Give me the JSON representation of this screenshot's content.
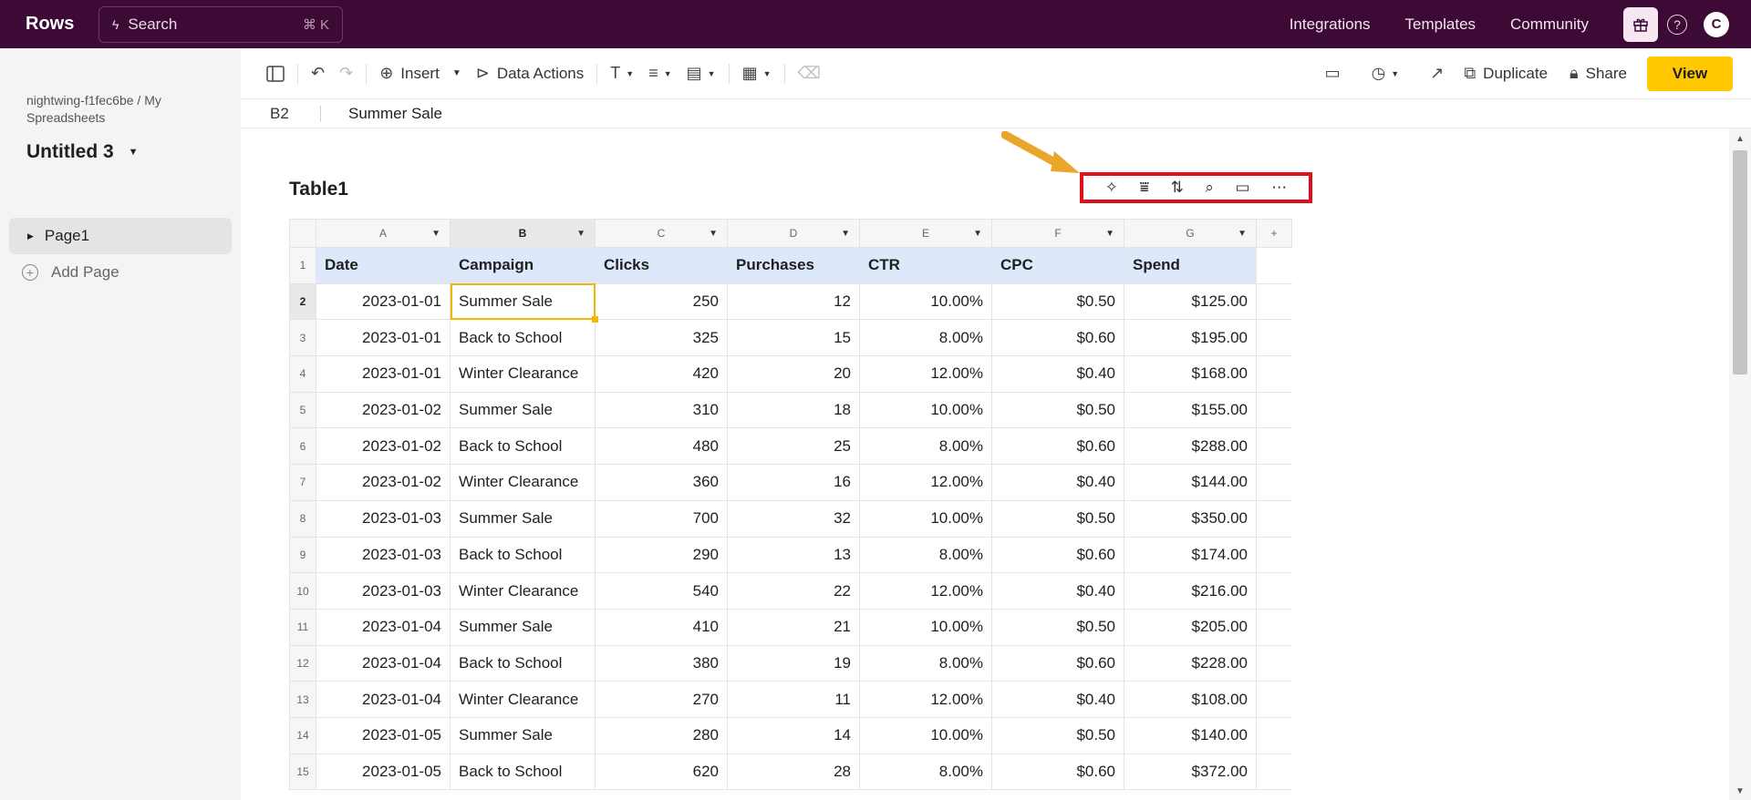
{
  "app": {
    "logo": "Rows",
    "search_label": "Search",
    "search_shortcut": "⌘ K",
    "nav": [
      "Integrations",
      "Templates",
      "Community"
    ],
    "avatar_initial": "C"
  },
  "sidebar": {
    "breadcrumb": "nightwing-f1fec6be / My Spreadsheets",
    "doc_title": "Untitled 3",
    "pages": [
      {
        "label": "Page1"
      }
    ],
    "add_page_label": "Add Page"
  },
  "toolbar": {
    "insert_label": "Insert",
    "data_actions_label": "Data Actions",
    "duplicate_label": "Duplicate",
    "share_label": "Share",
    "view_label": "View"
  },
  "formula_bar": {
    "cell_ref": "B2",
    "value": "Summer Sale"
  },
  "table": {
    "title": "Table1",
    "column_letters": [
      "A",
      "B",
      "C",
      "D",
      "E",
      "F",
      "G"
    ],
    "headers": [
      "Date",
      "Campaign",
      "Clicks",
      "Purchases",
      "CTR",
      "CPC",
      "Spend"
    ],
    "rows": [
      [
        "2023-01-01",
        "Summer Sale",
        "250",
        "12",
        "10.00%",
        "$0.50",
        "$125.00"
      ],
      [
        "2023-01-01",
        "Back to School",
        "325",
        "15",
        "8.00%",
        "$0.60",
        "$195.00"
      ],
      [
        "2023-01-01",
        "Winter Clearance",
        "420",
        "20",
        "12.00%",
        "$0.40",
        "$168.00"
      ],
      [
        "2023-01-02",
        "Summer Sale",
        "310",
        "18",
        "10.00%",
        "$0.50",
        "$155.00"
      ],
      [
        "2023-01-02",
        "Back to School",
        "480",
        "25",
        "8.00%",
        "$0.60",
        "$288.00"
      ],
      [
        "2023-01-02",
        "Winter Clearance",
        "360",
        "16",
        "12.00%",
        "$0.40",
        "$144.00"
      ],
      [
        "2023-01-03",
        "Summer Sale",
        "700",
        "32",
        "10.00%",
        "$0.50",
        "$350.00"
      ],
      [
        "2023-01-03",
        "Back to School",
        "290",
        "13",
        "8.00%",
        "$0.60",
        "$174.00"
      ],
      [
        "2023-01-03",
        "Winter Clearance",
        "540",
        "22",
        "12.00%",
        "$0.40",
        "$216.00"
      ],
      [
        "2023-01-04",
        "Summer Sale",
        "410",
        "21",
        "10.00%",
        "$0.50",
        "$205.00"
      ],
      [
        "2023-01-04",
        "Back to School",
        "380",
        "19",
        "8.00%",
        "$0.60",
        "$228.00"
      ],
      [
        "2023-01-04",
        "Winter Clearance",
        "270",
        "11",
        "12.00%",
        "$0.40",
        "$108.00"
      ],
      [
        "2023-01-05",
        "Summer Sale",
        "280",
        "14",
        "10.00%",
        "$0.50",
        "$140.00"
      ],
      [
        "2023-01-05",
        "Back to School",
        "620",
        "28",
        "8.00%",
        "$0.60",
        "$372.00"
      ]
    ],
    "selected_cell": "B2"
  },
  "colors": {
    "topbar": "#3d0a36",
    "accent_button": "#ffc800",
    "header_fill": "#dde9fb",
    "highlight_box": "#e0101a",
    "annotation_arrow": "#e8a72a"
  }
}
